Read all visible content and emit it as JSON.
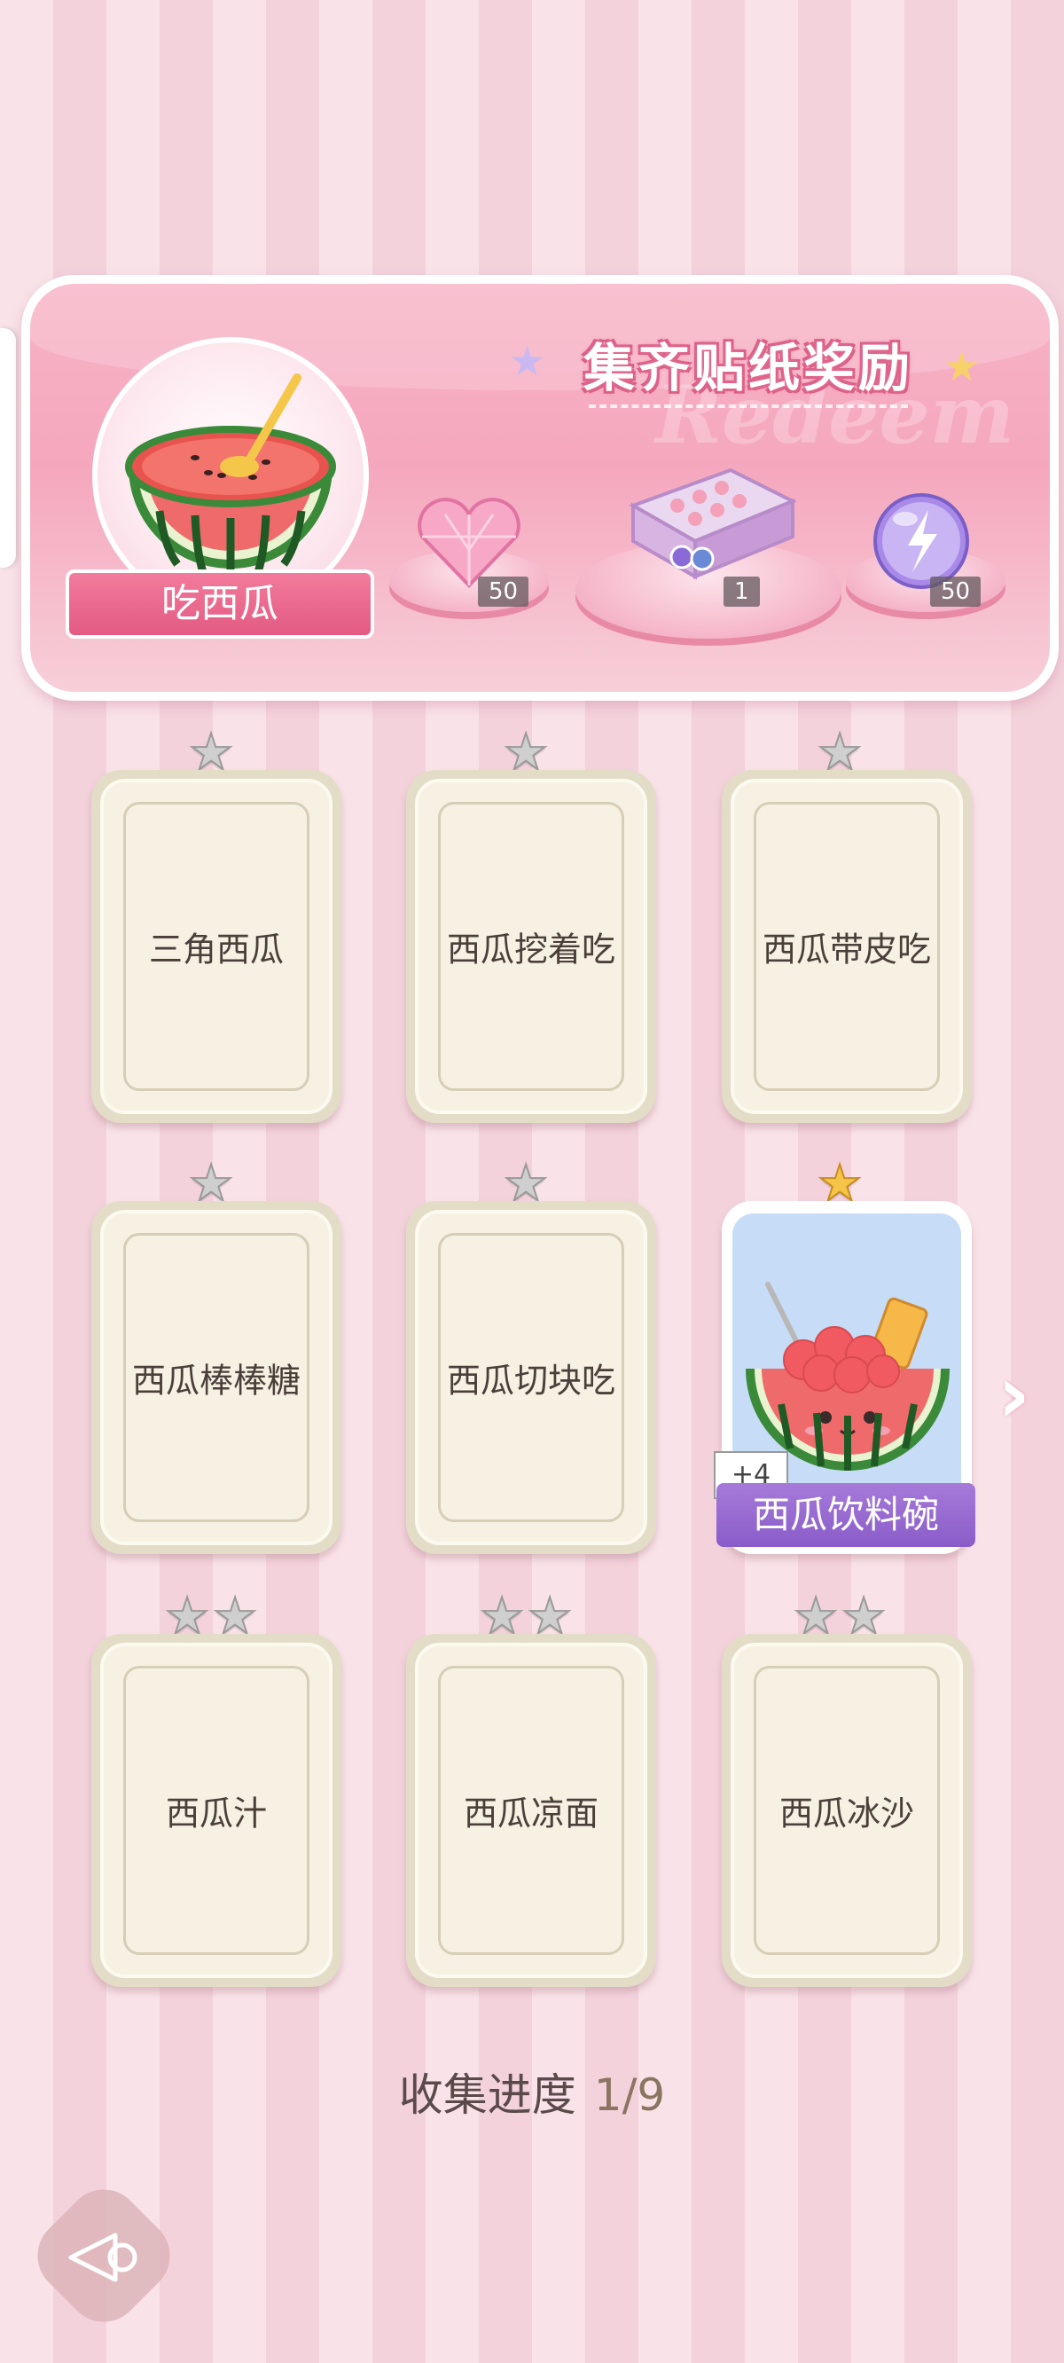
{
  "banner": {
    "title": "集齐贴纸奖励",
    "watermark": "Redeem",
    "theme_name": "吃西瓜",
    "rewards": [
      {
        "icon": "pink-heart-gem-icon",
        "count": "50"
      },
      {
        "icon": "gift-box-icon",
        "count": "1"
      },
      {
        "icon": "purple-energy-orb-icon",
        "count": "50"
      }
    ]
  },
  "cards": [
    {
      "name": "三角西瓜",
      "stars": 1,
      "collected": false
    },
    {
      "name": "西瓜挖着吃",
      "stars": 1,
      "collected": false
    },
    {
      "name": "西瓜带皮吃",
      "stars": 1,
      "collected": false
    },
    {
      "name": "西瓜棒棒糖",
      "stars": 1,
      "collected": false
    },
    {
      "name": "西瓜切块吃",
      "stars": 1,
      "collected": false
    },
    {
      "name": "西瓜饮料碗",
      "stars": 1,
      "collected": true,
      "bonus": "+4"
    },
    {
      "name": "西瓜汁",
      "stars": 2,
      "collected": false
    },
    {
      "name": "西瓜凉面",
      "stars": 2,
      "collected": false
    },
    {
      "name": "西瓜冰沙",
      "stars": 2,
      "collected": false
    }
  ],
  "progress": {
    "label": "收集进度",
    "value": "1/9"
  },
  "colors": {
    "accent": "#f27b9c",
    "collected_label": "#8a5cc9",
    "star_gold": "#f5c54a"
  }
}
